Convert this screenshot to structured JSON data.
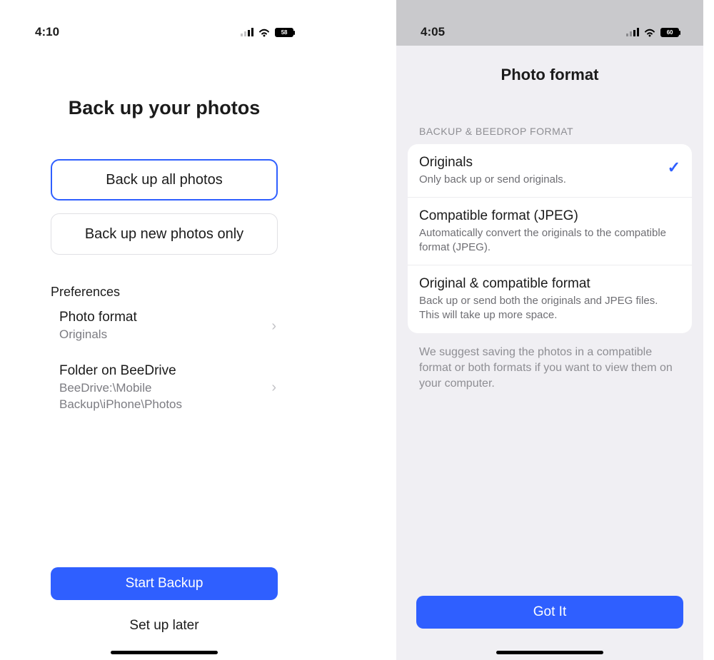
{
  "left": {
    "status": {
      "time": "4:10",
      "battery": "58"
    },
    "title": "Back up your photos",
    "options": [
      "Back up all photos",
      "Back up new photos only"
    ],
    "prefs_label": "Preferences",
    "prefs": [
      {
        "title": "Photo format",
        "sub": "Originals"
      },
      {
        "title": "Folder on BeeDrive",
        "sub": "BeeDrive:\\Mobile Backup\\iPhone\\Photos"
      }
    ],
    "start_btn": "Start Backup",
    "later_btn": "Set up later"
  },
  "right": {
    "status": {
      "time": "4:05",
      "battery": "60"
    },
    "title": "Photo format",
    "section": "BACKUP & BEEDROP FORMAT",
    "options": [
      {
        "title": "Originals",
        "sub": "Only back up or send originals.",
        "selected": true
      },
      {
        "title": "Compatible format (JPEG)",
        "sub": "Automatically convert the originals to the compatible format (JPEG).",
        "selected": false
      },
      {
        "title": "Original & compatible format",
        "sub": "Back up or send both the originals and JPEG files. This will take up more space.",
        "selected": false
      }
    ],
    "hint": "We suggest saving the photos in a compatible format or both formats if you want to view them on your computer.",
    "got_it": "Got It"
  }
}
